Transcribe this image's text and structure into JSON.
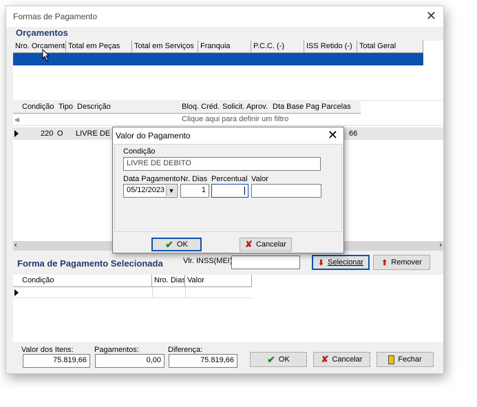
{
  "window": {
    "title": "Formas de Pagamento"
  },
  "orcamentos": {
    "title": "Orçamentos",
    "columns": [
      "Nro. Orcamento",
      "Total em Peças",
      "Total em Serviços",
      "Franquia",
      "P.C.C. (-)",
      "ISS Retido (-)",
      "Total Geral"
    ]
  },
  "condicoes": {
    "columns": [
      "Condição",
      "Tipo",
      "Descrição",
      "Bloq. Créd.",
      "Solicit. Aprov.",
      "Dta Base Pag.",
      "Parcelas"
    ],
    "filter_text": "Clique aqui para definir um filtro",
    "row": {
      "condicao": "220",
      "tipo": "O",
      "descricao": "LIVRE DE DE",
      "parcelas": "66"
    }
  },
  "selected": {
    "title": "Forma de Pagamento Selecionada",
    "inss_label": "Vlr. INSS(MEI):",
    "inss_value": "",
    "selecionar_label": "Selecionar",
    "remover_label": "Remover",
    "columns": [
      "Condição",
      "Nro. Dias",
      "Valor"
    ]
  },
  "footer": {
    "valor_itens_label": "Valor dos Itens:",
    "valor_itens": "75.819,66",
    "pagamentos_label": "Pagamentos:",
    "pagamentos": "0,00",
    "diferenca_label": "Diferença:",
    "diferenca": "75.819,66",
    "ok_label": "OK",
    "cancelar_label": "Cancelar",
    "fechar_label": "Fechar"
  },
  "dialog": {
    "title": "Valor do Pagamento",
    "condicao_label": "Condição",
    "condicao_value": "LIVRE DE DEBITO",
    "data_label": "Data Pagamento",
    "data_value": "05/12/2023",
    "dias_label": "Nr. Dias",
    "dias_value": "1",
    "percentual_label": "Percentual",
    "percentual_value": "",
    "valor_label": "Valor",
    "valor_value": "",
    "ok_label": "OK",
    "cancelar_label": "Cancelar"
  },
  "colors": {
    "selection": "#0a52b0",
    "section_title": "#1f3c70",
    "ok_check": "#1a8a1a",
    "cancel_x": "#c0201c"
  }
}
